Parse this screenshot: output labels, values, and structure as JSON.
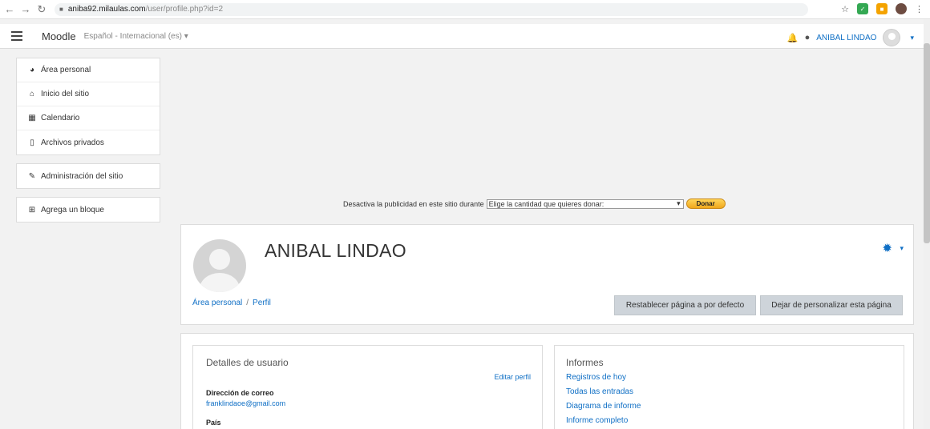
{
  "browser": {
    "url_host": "aniba92.milaulas.com",
    "url_path": "/user/profile.php?id=2"
  },
  "navbar": {
    "brand": "Moodle",
    "language": "Español - Internacional (es) ▾",
    "user_name": "ANIBAL LINDAO"
  },
  "sidebar": {
    "nav": [
      {
        "label": "Área personal",
        "icon": "dashboard-icon"
      },
      {
        "label": "Inicio del sitio",
        "icon": "home-icon"
      },
      {
        "label": "Calendario",
        "icon": "calendar-icon"
      },
      {
        "label": "Archivos privados",
        "icon": "file-icon"
      }
    ],
    "admin": {
      "label": "Administración del sitio",
      "icon": "wrench-icon"
    },
    "add_block": {
      "label": "Agrega un bloque",
      "icon": "plus-square-icon"
    }
  },
  "ad": {
    "text": "Desactiva la publicidad en este sitio durante",
    "select_value": "Elige la cantidad que quieres donar:",
    "donate_label": "Donar"
  },
  "profile": {
    "name": "ANIBAL LINDAO",
    "breadcrumb": [
      "Área personal",
      "Perfil"
    ],
    "reset_button": "Restablecer página a por defecto",
    "stop_button": "Dejar de personalizar esta página"
  },
  "user_details": {
    "title": "Detalles de usuario",
    "edit_link": "Editar perfil",
    "email_label": "Dirección de correo",
    "email_value": "franklindaoe@gmail.com",
    "country_label": "País"
  },
  "reports": {
    "title": "Informes",
    "links": [
      "Registros de hoy",
      "Todas las entradas",
      "Diagrama de informe",
      "Informe completo"
    ]
  },
  "colors": {
    "link": "#0f6fc5",
    "button_gray": "#ced4da",
    "background": "#f2f2f2"
  }
}
